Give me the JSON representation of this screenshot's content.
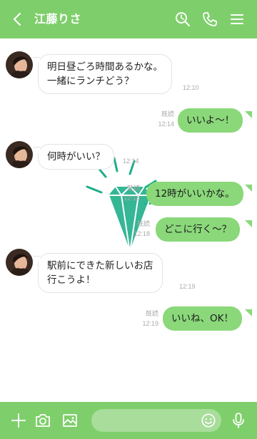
{
  "header": {
    "title": "江藤りさ",
    "back_icon": "chevron-left-icon",
    "search_icon": "search-icon",
    "call_icon": "phone-icon",
    "menu_icon": "menu-icon",
    "bg_color": "#7ecf6b"
  },
  "messages": [
    {
      "direction": "in",
      "lines": [
        "明日昼ごろ時間あるかな。",
        "一緒にランチどう？"
      ],
      "time": "12:10"
    },
    {
      "direction": "out",
      "text": "いいよ～！",
      "read": "既読",
      "time": "12:14"
    },
    {
      "direction": "in",
      "text": "何時がいい？",
      "time": "12:14"
    },
    {
      "direction": "out",
      "text": "12時がいいかな。",
      "read": "既読",
      "time": "12:18"
    },
    {
      "direction": "out",
      "text": "どこに行く～？",
      "read": "既読",
      "time": "12:18"
    },
    {
      "direction": "in",
      "lines": [
        "駅前にできた新しいお店",
        "行こうよ！"
      ],
      "time": "12:19"
    },
    {
      "direction": "out",
      "text": "いいね、OK！",
      "read": "既読",
      "time": "12:19"
    }
  ],
  "bottom": {
    "add_icon": "plus-icon",
    "camera_icon": "camera-icon",
    "image_icon": "image-icon",
    "input_value": "",
    "emoji_icon": "emoji-icon",
    "mic_icon": "mic-icon"
  },
  "colors": {
    "accent": "#7ecf6b",
    "out_bubble": "#8ad87a",
    "diamond": "#1fae8a"
  }
}
